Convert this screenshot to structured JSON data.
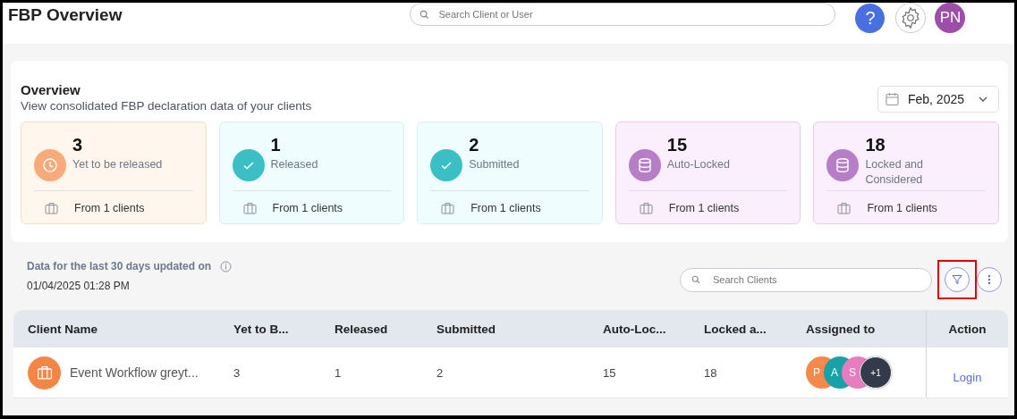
{
  "header": {
    "title": "FBP Overview",
    "search": {
      "placeholder": "Search Client or User"
    },
    "help": "?",
    "avatar": "PN"
  },
  "overview": {
    "title": "Overview",
    "subtitle": "View consolidated FBP declaration data of your clients",
    "month": "Feb, 2025",
    "cards": [
      {
        "kind": "pending",
        "count": "3",
        "label": "Yet to be released",
        "footer": "From 1 clients"
      },
      {
        "kind": "done",
        "count": "1",
        "label": "Released",
        "footer": "From 1 clients"
      },
      {
        "kind": "done",
        "count": "2",
        "label": "Submitted",
        "footer": "From 1 clients"
      },
      {
        "kind": "locked",
        "count": "15",
        "label": "Auto-Locked",
        "footer": "From 1 clients"
      },
      {
        "kind": "locked",
        "count": "18",
        "label": "Locked and Considered",
        "footer": "From 1 clients"
      }
    ]
  },
  "update": {
    "label": "Data for the last 30 days updated on",
    "time": "01/04/2025 01:28 PM"
  },
  "client_search": {
    "placeholder": "Search Clients"
  },
  "filter_highlighted": true,
  "table": {
    "columns": [
      "Client Name",
      "Yet to B...",
      "Released",
      "Submitted",
      "Auto-Loc...",
      "Locked a...",
      "Assigned to",
      "Action"
    ],
    "rows": [
      {
        "cells": [
          "Event Workflow greyt...",
          "3",
          "1",
          "2",
          "15",
          "18"
        ],
        "assignees": [
          {
            "initials": "P",
            "color": "#f5884a"
          },
          {
            "initials": "A",
            "color": "#17a2a8"
          },
          {
            "initials": "S",
            "color": "#e97bbf"
          }
        ],
        "more": "+1",
        "action": "Login"
      }
    ]
  }
}
